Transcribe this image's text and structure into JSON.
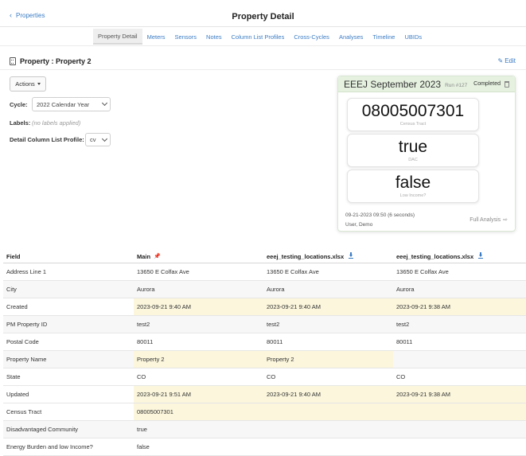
{
  "header": {
    "back_label": "Properties",
    "title": "Property Detail"
  },
  "tabs": [
    {
      "label": "Property Detail",
      "active": true
    },
    {
      "label": "Meters"
    },
    {
      "label": "Sensors"
    },
    {
      "label": "Notes"
    },
    {
      "label": "Column List Profiles"
    },
    {
      "label": "Cross-Cycles"
    },
    {
      "label": "Analyses"
    },
    {
      "label": "Timeline"
    },
    {
      "label": "UBIDs"
    }
  ],
  "property": {
    "title": "Property : Property 2",
    "edit_label": "Edit"
  },
  "controls": {
    "actions_label": "Actions",
    "cycle_label": "Cycle:",
    "cycle_value": "2022 Calendar Year",
    "labels_label": "Labels:",
    "labels_value": "(no labels applied)",
    "profile_label": "Detail Column List Profile:",
    "profile_value": "cv"
  },
  "analysis": {
    "name": "EEEJ September 2023",
    "run": "Run #127",
    "status": "Completed",
    "metrics": [
      {
        "value": "08005007301",
        "caption": "Census Tract"
      },
      {
        "value": "true",
        "caption": "DAC"
      },
      {
        "value": "false",
        "caption": "Low Income?"
      }
    ],
    "date": "09-21-2023 09:50 (6 seconds)",
    "user": "User, Demo",
    "full_analysis_label": "Full Analysis"
  },
  "table": {
    "headers": [
      "Field",
      "Main",
      "eeej_testing_locations.xlsx",
      "eeej_testing_locations.xlsx"
    ],
    "rows": [
      [
        "Address Line 1",
        "13650 E Colfax Ave",
        "13650 E Colfax Ave",
        "13650 E Colfax Ave"
      ],
      [
        "City",
        "Aurora",
        "Aurora",
        "Aurora"
      ],
      [
        "Created",
        "2023-09-21 9:40 AM",
        "2023-09-21 9:40 AM",
        "2023-09-21 9:38 AM"
      ],
      [
        "PM Property ID",
        "test2",
        "test2",
        "test2"
      ],
      [
        "Postal Code",
        "80011",
        "80011",
        "80011"
      ],
      [
        "Property Name",
        "Property 2",
        "Property 2",
        ""
      ],
      [
        "State",
        "CO",
        "CO",
        "CO"
      ],
      [
        "Updated",
        "2023-09-21 9:51 AM",
        "2023-09-21 9:40 AM",
        "2023-09-21 9:38 AM"
      ],
      [
        "Census Tract",
        "08005007301",
        "",
        ""
      ],
      [
        "Disadvantaged Community",
        "true",
        "",
        ""
      ],
      [
        "Energy Burden and low Income?",
        "false",
        "",
        ""
      ]
    ]
  },
  "colors": {
    "link": "#3b7cc4",
    "highlight": "#fbf6dc",
    "card_header": "#e6f1e0"
  }
}
